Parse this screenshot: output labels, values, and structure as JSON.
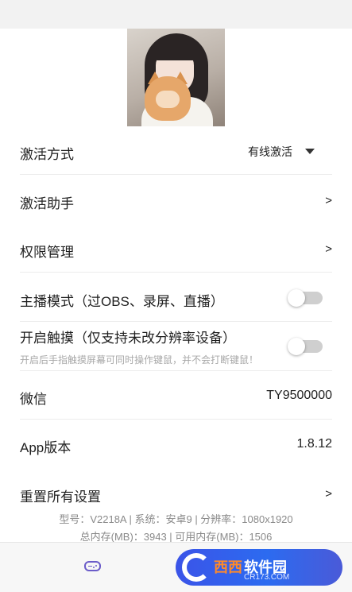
{
  "settings": {
    "activation_method": {
      "label": "激活方式",
      "selected": "有线激活"
    },
    "activation_helper": {
      "label": "激活助手",
      "arrow": ">"
    },
    "permission_management": {
      "label": "权限管理",
      "arrow": ">"
    },
    "streamer_mode": {
      "label": "主播模式（过OBS、录屏、直播）",
      "enabled": false
    },
    "touch_mode": {
      "label": "开启触摸（仅支持未改分辨率设备）",
      "subtext": "开启后手指触摸屏幕可同时操作键鼠，并不会打断键鼠！",
      "enabled": false
    },
    "wechat": {
      "label": "微信",
      "value": "TY9500000"
    },
    "app_version": {
      "label": "App版本",
      "value": "1.8.12"
    },
    "reset_all": {
      "label": "重置所有设置",
      "arrow": ">"
    }
  },
  "device_info": {
    "line1": "型号：V2218A | 系统：安卓9 | 分辨率：1080x1920",
    "line2": "总内存(MB)：3943 | 可用内存(MB)：1506"
  },
  "bottom_bar": {
    "nav_icon": "gamepad-icon",
    "watermark": {
      "part1": "西西",
      "part2": "软件园",
      "url": "CR173.COM"
    }
  },
  "colors": {
    "accent": "#6b5cc9",
    "divider": "#ececec",
    "toggle_off": "#cfcfcf",
    "brand_blue": "#2c6bf0",
    "brand_orange": "#ff8a2a"
  }
}
